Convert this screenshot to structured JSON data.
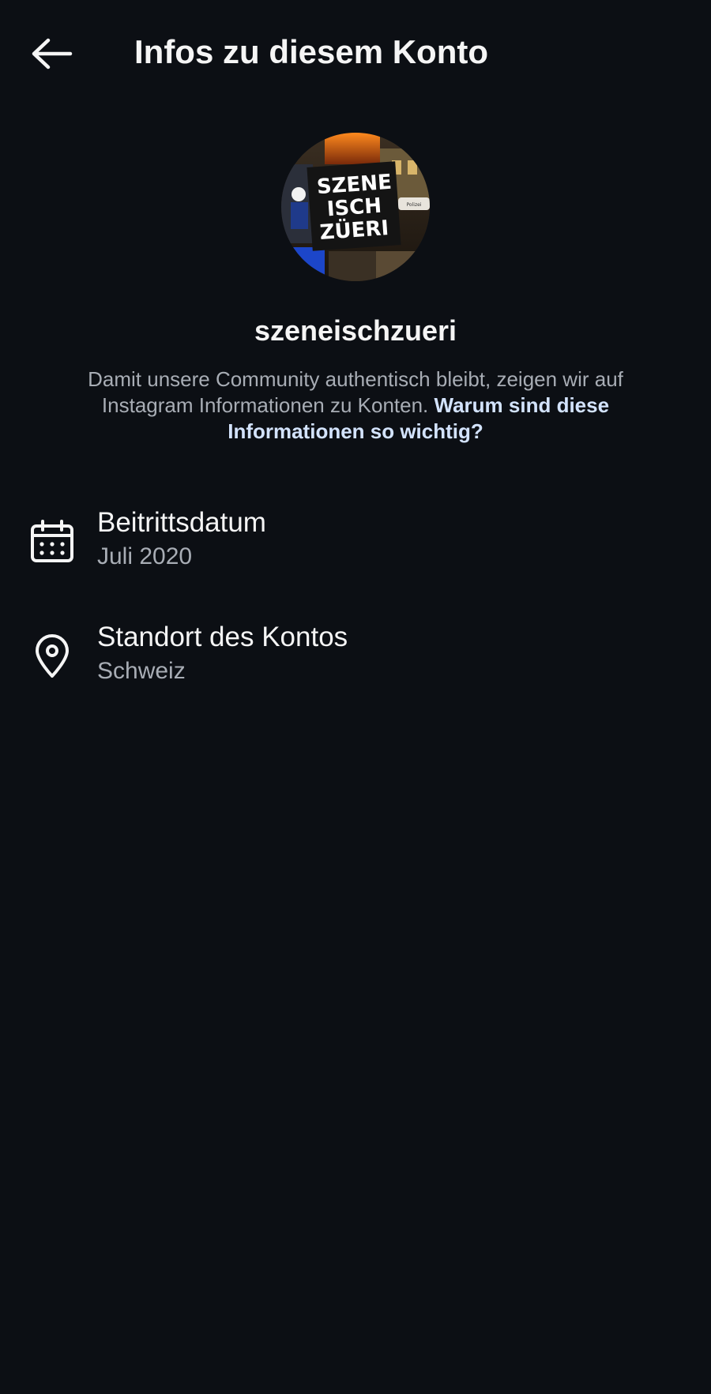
{
  "header": {
    "title": "Infos zu diesem Konto",
    "back_icon": "arrow-left-icon"
  },
  "profile": {
    "username": "szeneischzueri",
    "avatar_text": [
      "SZENE",
      "ISCH",
      "ZÜERI"
    ],
    "avatar_overlay_text": "Polizei"
  },
  "description": {
    "text": "Damit unsere Community authentisch bleibt, zeigen wir auf Instagram Informationen zu Konten.",
    "link": "Warum sind diese Informationen so wichtig?"
  },
  "info": [
    {
      "icon": "calendar-icon",
      "label": "Beitrittsdatum",
      "value": "Juli 2020"
    },
    {
      "icon": "location-pin-icon",
      "label": "Standort des Kontos",
      "value": "Schweiz"
    }
  ],
  "colors": {
    "background": "#0c0f14",
    "text_primary": "#f5f5f5",
    "text_secondary": "#a8adb5",
    "link": "#d3e3fd"
  }
}
